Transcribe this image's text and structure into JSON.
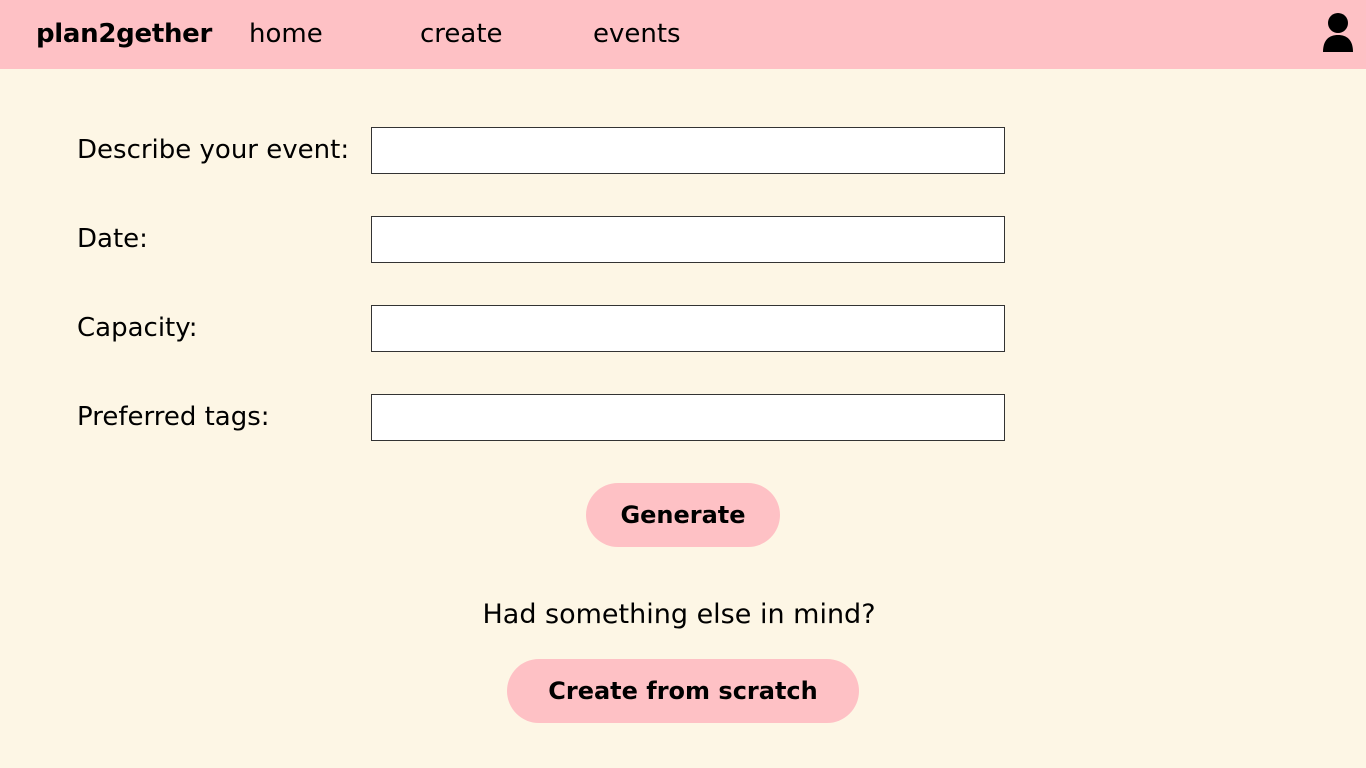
{
  "nav": {
    "brand": "plan2gether",
    "links": [
      "home",
      "create",
      "events"
    ],
    "user_icon": "user-icon",
    "bar_color": "#fec1c5"
  },
  "form": {
    "fields": [
      {
        "label": "Describe your event:",
        "value": ""
      },
      {
        "label": "Date:",
        "value": ""
      },
      {
        "label": "Capacity:",
        "value": ""
      },
      {
        "label": "Preferred tags:",
        "value": ""
      }
    ],
    "generate_label": "Generate"
  },
  "alternative": {
    "prompt": "Had something else in mind?",
    "scratch_label": "Create from scratch"
  },
  "colors": {
    "page_background": "#fdf6e5",
    "accent": "#fec1c5"
  }
}
